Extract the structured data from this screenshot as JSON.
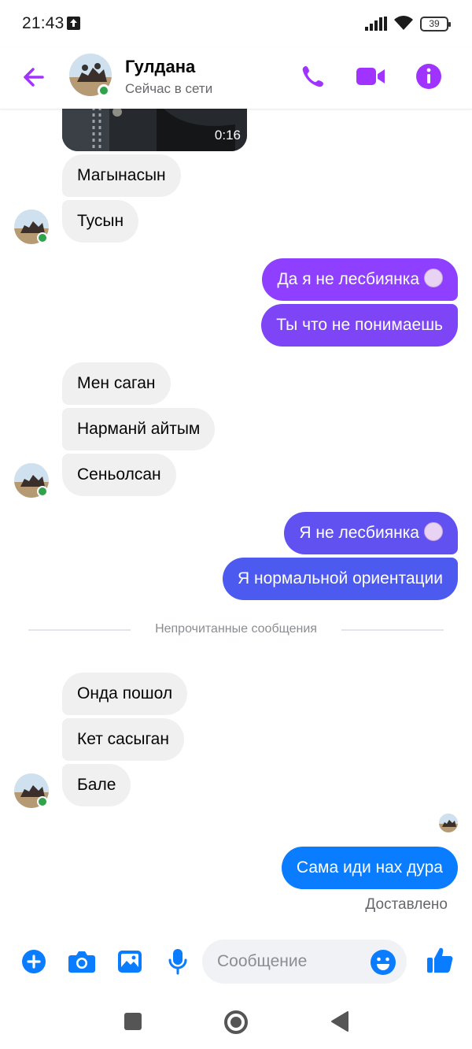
{
  "status_bar": {
    "time": "21:43",
    "battery": "39"
  },
  "header": {
    "contact_name": "Гулдана",
    "contact_status": "Сейчас в сети"
  },
  "video": {
    "duration": "0:16"
  },
  "messages": {
    "m1": "Магынасын",
    "m2": "Тусын",
    "m3": "Да я не лесбиянка",
    "m4": "Ты что не понимаешь",
    "m5": "Мен саган",
    "m6": "Нарманй айтым",
    "m7": "Сеньолсан",
    "m8": "Я не лесбиянка",
    "m9": "Я нормальной ориентации",
    "m10": "Онда пошол",
    "m11": "Кет сасыган",
    "m12": "Бале",
    "m13": "Сама иди нах дура"
  },
  "divider_text": "Непрочитанные сообщения",
  "delivered_text": "Доставлено",
  "composer": {
    "placeholder": "Сообщение"
  },
  "colors": {
    "accent": "#a033ff",
    "blue": "#0a7cff",
    "incoming_bubble": "#f0f0f0",
    "online": "#31a24c"
  },
  "icons": [
    "back-arrow-icon",
    "phone-icon",
    "video-call-icon",
    "info-icon",
    "plus-icon",
    "camera-icon",
    "gallery-icon",
    "microphone-icon",
    "emoji-icon",
    "thumbs-up-icon"
  ]
}
